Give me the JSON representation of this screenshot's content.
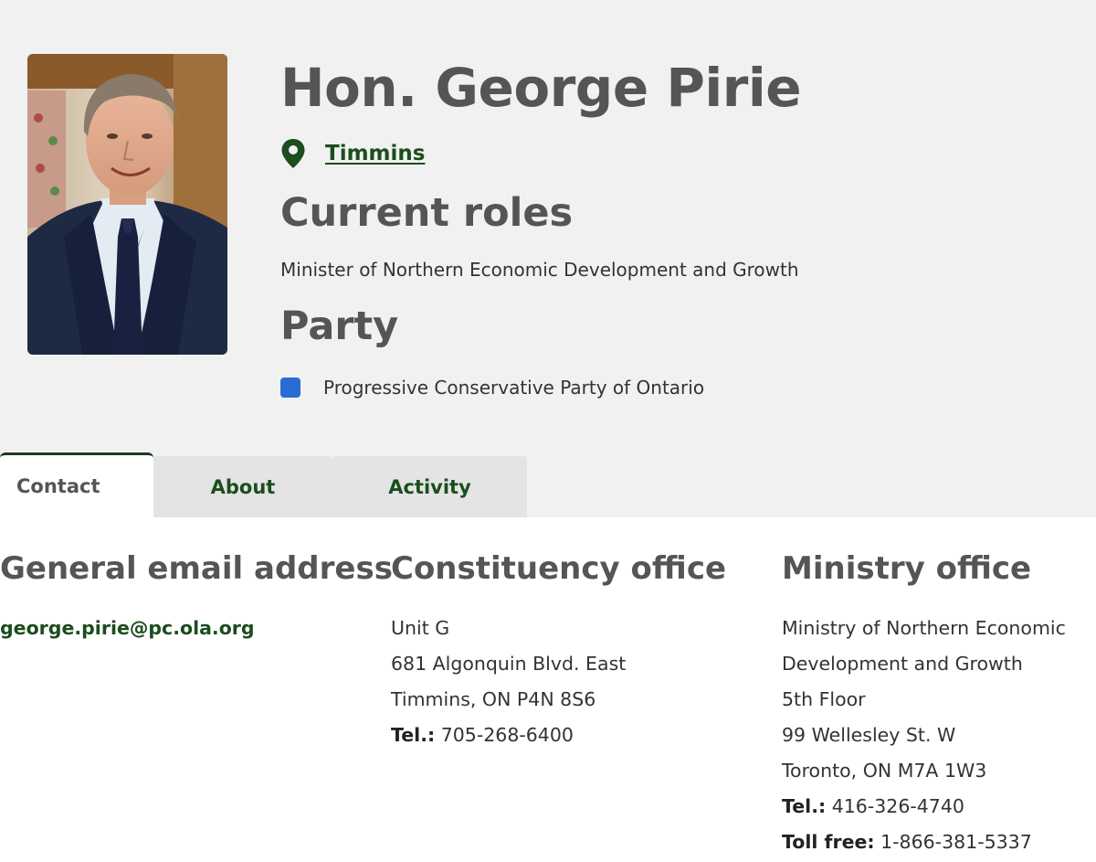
{
  "member": {
    "name": "Hon. George Pirie",
    "riding": "Timmins",
    "roles_heading": "Current roles",
    "role": "Minister of Northern Economic Development and Growth",
    "party_heading": "Party",
    "party": "Progressive Conservative Party of Ontario",
    "party_color": "#2a6cd4"
  },
  "tabs": [
    {
      "label": "Contact",
      "active": true
    },
    {
      "label": "About",
      "active": false
    },
    {
      "label": "Activity",
      "active": false
    }
  ],
  "contact": {
    "email_heading": "General email address",
    "email": "george.pirie@pc.ola.org",
    "constituency_heading": "Constituency office",
    "constituency_lines": [
      "Unit G",
      "681 Algonquin Blvd. East",
      "Timmins, ON P4N 8S6"
    ],
    "constituency_tel_label": "Tel.:",
    "constituency_tel": "705-268-6400",
    "ministry_heading": "Ministry office",
    "ministry_lines": [
      "Ministry of Northern Economic",
      "Development and Growth",
      "5th Floor",
      "99 Wellesley St. W",
      "Toronto, ON M7A 1W3"
    ],
    "ministry_tel_label": "Tel.:",
    "ministry_tel": "416-326-4740",
    "ministry_tollfree_label": "Toll free:",
    "ministry_tollfree": "1-866-381-5337"
  },
  "icons": {
    "riding": "location-pin-icon",
    "party": "party-color-swatch"
  },
  "colors": {
    "accent_green": "#1b4d1e",
    "hero_bg": "#f1f1f1"
  }
}
